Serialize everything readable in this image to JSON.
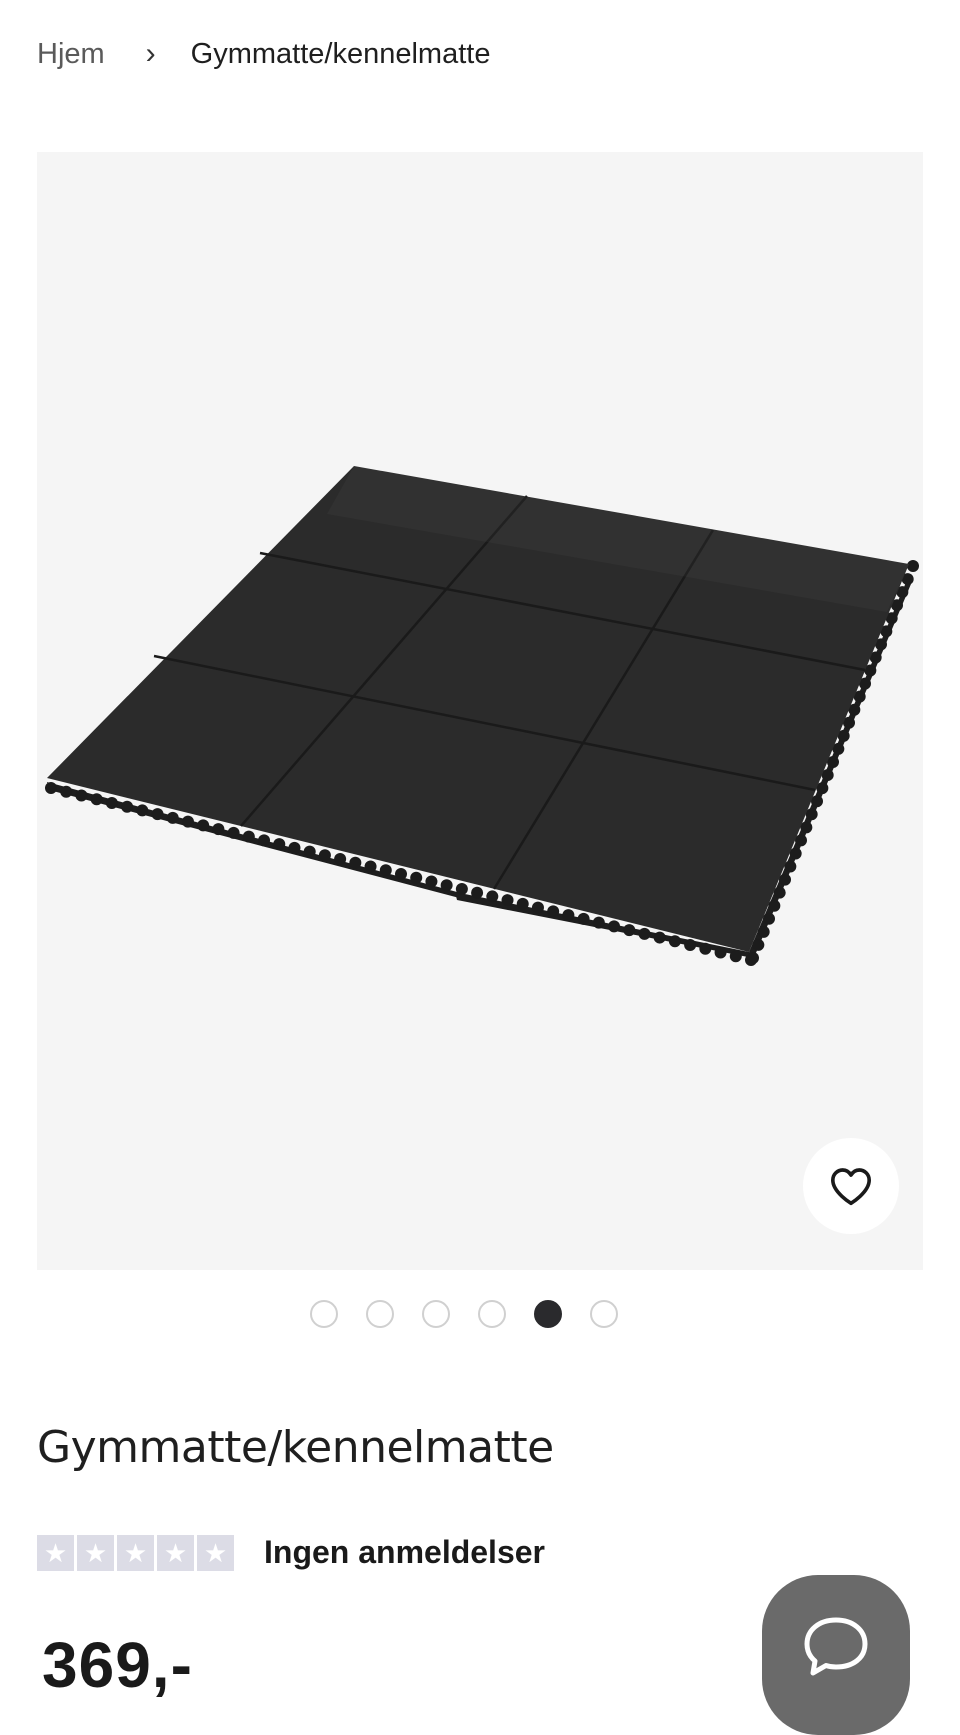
{
  "breadcrumb": {
    "home_label": "Hjem",
    "separator_icon": "chevron-right-icon",
    "current_label": "Gymmatte/kennelmatte"
  },
  "gallery": {
    "wishlist_icon": "heart-icon",
    "dot_count": 6,
    "active_dot": 5
  },
  "product": {
    "title": "Gymmatte/kennelmatte",
    "rating_stars": 0,
    "rating_max": 5,
    "reviews_label": "Ingen anmeldelser",
    "price": "369,-"
  },
  "chat": {
    "icon": "chat-bubble-icon"
  },
  "colors": {
    "image_background": "#f5f5f5",
    "mat": "#2b2b2b",
    "active_dot": "#2a2a2d",
    "star_box": "#dcdce6",
    "chat_button": "#6a6a6a"
  }
}
